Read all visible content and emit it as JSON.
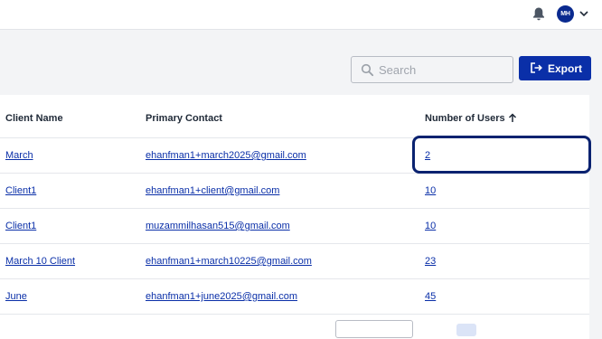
{
  "header": {
    "notification_icon": "bell-icon",
    "avatar_initials": "MH",
    "menu_icon": "chevron-down-icon"
  },
  "toolbar": {
    "search_placeholder": "Search",
    "search_value": "",
    "export_label": "Export"
  },
  "table": {
    "columns": [
      "Client Name",
      "Primary Contact",
      "Number of Users"
    ],
    "sort_icon": "arrow-up-icon",
    "rows": [
      {
        "client": "March",
        "contact": "ehanfman1+march2025@gmail.com",
        "users": "2"
      },
      {
        "client": "Client1",
        "contact": "ehanfman1+client@gmail.com",
        "users": "10"
      },
      {
        "client": "Client1",
        "contact": "muzammilhasan515@gmail.com",
        "users": "10"
      },
      {
        "client": "March 10 Client",
        "contact": "ehanfman1+march10225@gmail.com",
        "users": "23"
      },
      {
        "client": "June",
        "contact": "ehanfman1+june2025@gmail.com",
        "users": "45"
      }
    ]
  },
  "colors": {
    "accent": "#0a2fa8",
    "focus_ring": "#0a2270"
  }
}
